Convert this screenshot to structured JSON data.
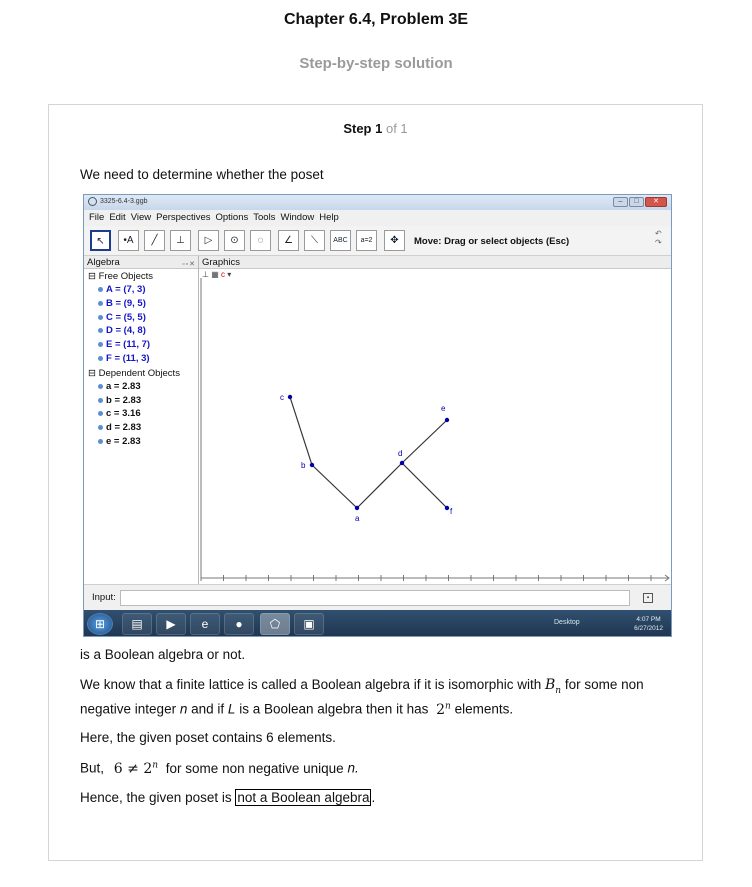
{
  "page": {
    "chapter_title": "Chapter 6.4, Problem 3E",
    "subtitle": "Step-by-step solution"
  },
  "step": {
    "label": "Step 1",
    "of_text": "of 1"
  },
  "content": {
    "intro": "We need to determine whether the poset",
    "after_image": "is a Boolean algebra or not.",
    "p1_start": "We know that a finite lattice is called a Boolean algebra if it is isomorphic with",
    "p1_math_B": "B",
    "p1_math_sub": "n",
    "p1_end": "for some non",
    "p2_start": "negative integer",
    "p2_n": "n",
    "p2_mid": "and if",
    "p2_L": "L",
    "p2_rest": "is a Boolean algebra then it has",
    "p2_math": "2",
    "p2_exp": "n",
    "p2_end": "elements.",
    "p3": "Here, the given poset contains 6 elements.",
    "p4_start": "But,",
    "p4_math": "6 ≠ 2",
    "p4_exp": "n",
    "p4_end": "for some non negative unique",
    "p4_n": "n.",
    "p5_start": "Hence, the given poset is",
    "p5_boxed": "not a Boolean algebra",
    "p5_end": "."
  },
  "geogebra": {
    "window_title": "3325-6.4-3.ggb",
    "menu": [
      "File",
      "Edit",
      "View",
      "Perspectives",
      "Options",
      "Tools",
      "Window",
      "Help"
    ],
    "tools": [
      {
        "name": "move-tool",
        "glyph": "↖"
      },
      {
        "name": "point-tool",
        "glyph": "•A"
      },
      {
        "name": "line-tool",
        "glyph": "╱"
      },
      {
        "name": "perpendicular-tool",
        "glyph": "⊥"
      },
      {
        "name": "polygon-tool",
        "glyph": "▷"
      },
      {
        "name": "circle-tool",
        "glyph": "⊙"
      },
      {
        "name": "conic-tool",
        "glyph": "◌"
      },
      {
        "name": "angle-tool",
        "glyph": "∠"
      },
      {
        "name": "reflect-tool",
        "glyph": "⟍"
      },
      {
        "name": "text-tool",
        "glyph": "ABC"
      },
      {
        "name": "slider-tool",
        "glyph": "a=2"
      },
      {
        "name": "move-view-tool",
        "glyph": "✥"
      }
    ],
    "move_hint": "Move: Drag or select objects (Esc)",
    "algebra_header": "Algebra",
    "graphics_header": "Graphics",
    "free_objects_label": "Free Objects",
    "free_objects": [
      "A = (7, 3)",
      "B = (9, 5)",
      "C = (5, 5)",
      "D = (4, 8)",
      "E = (11, 7)",
      "F = (11, 3)"
    ],
    "dependent_objects_label": "Dependent Objects",
    "dependent_objects": [
      "a = 2.83",
      "b = 2.83",
      "c = 3.16",
      "d = 2.83",
      "e = 2.83"
    ],
    "input_label": "Input:",
    "taskbar": {
      "desktop_label": "Desktop",
      "time": "4:07 PM",
      "date": "6/27/2012"
    },
    "point_color": "#0000aa",
    "segment_color": "#333333",
    "hasse_labels": [
      "c",
      "b",
      "a",
      "d",
      "e",
      "f"
    ]
  }
}
